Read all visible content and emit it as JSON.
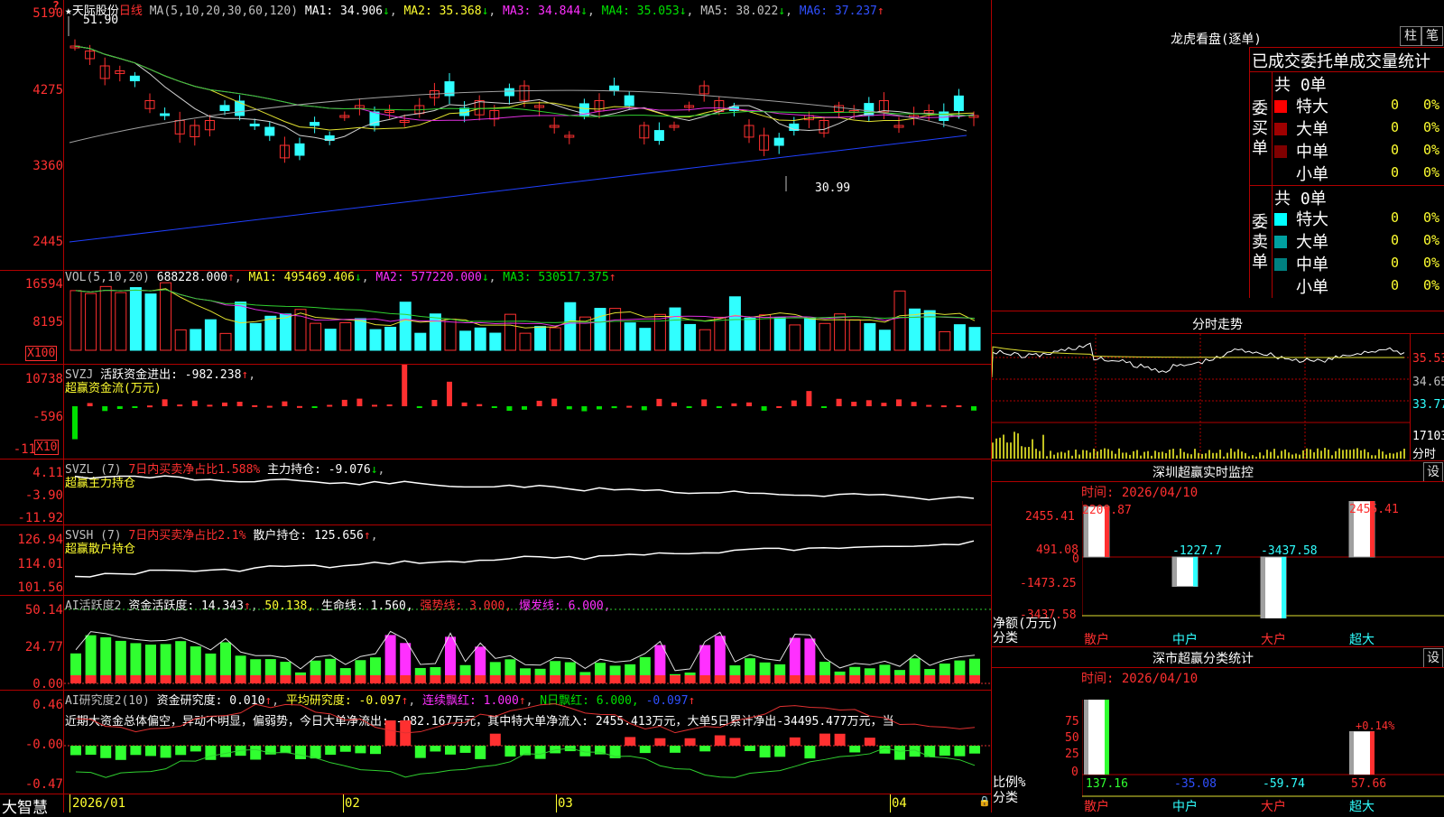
{
  "main": {
    "stock_name": "天际股份",
    "period": "日线",
    "ma_label": "MA(5,10,20,30,60,120)",
    "ma1": "MA1: 34.906",
    "ma2": "MA2: 35.368",
    "ma3": "MA3: 34.844",
    "ma4": "MA4: 35.053",
    "ma5": "MA5: 38.022",
    "ma6": "MA6: 37.237",
    "high_mark": "51.90",
    "low_mark": "30.99",
    "y_ticks": [
      "5190",
      "4275",
      "3360",
      "2445"
    ]
  },
  "vol": {
    "label": "VOL(5,10,20)",
    "value": "688228.000",
    "ma1": "MA1: 495469.406",
    "ma2": "MA2: 577220.000",
    "ma3": "MA3: 530517.375",
    "y_ticks": [
      "16594",
      "8195"
    ],
    "unit": "X100"
  },
  "svzj": {
    "label": "SVZJ",
    "text": "活跃资金进出: -982.238",
    "sub": "超赢资金流(万元)",
    "y_ticks": [
      "10738",
      "-596",
      "-11"
    ],
    "unit": "X10"
  },
  "svzl": {
    "label": "SVZL (7)",
    "text1": "7日内买卖净占比1.588%",
    "text2": "主力持仓: -9.076",
    "sub": "超赢主力持仓",
    "y_ticks": [
      "4.11",
      "-3.90",
      "-11.92"
    ]
  },
  "svsh": {
    "label": "SVSH (7)",
    "text1": "7日内买卖净占比2.1%",
    "text2": "散户持仓: 125.656",
    "sub": "超赢散户持仓",
    "y_ticks": [
      "126.94",
      "114.01",
      "101.56"
    ]
  },
  "ai1": {
    "label": "AI活跃度2",
    "text1": "资金活跃度: 14.343",
    "text2": "50.138,",
    "text3": "生命线: 1.560,",
    "text4": "强势线: 3.000,",
    "text5": "爆发线: 6.000,",
    "y_ticks": [
      "50.14",
      "24.77",
      "0.00"
    ]
  },
  "ai2": {
    "label": "AI研究度2(10)",
    "text1": "资金研究度: 0.010",
    "text2": "平均研究度: -0.097",
    "text3": "连续飘红: 1.000",
    "text4": "N日飘红: 6.000,",
    "text5": "-0.097",
    "comment": "近期大资金总体偏空，异动不明显，偏弱势，今日大单净流出: -982.167万元，其中特大单净流入: 2455.413万元，大单5日累计净出-34495.477万元，当",
    "y_ticks": [
      "0.46",
      "-0.00",
      "-0.47"
    ]
  },
  "bottom": {
    "brand": "大智慧",
    "dates": [
      "2026/01",
      "02",
      "03",
      "04"
    ]
  },
  "right": {
    "lhb_title": "龙虎看盘(逐单)",
    "btn_col": "柱",
    "btn_pen": "笔",
    "tabs_title": "已成交委托单成交量统计",
    "buy_group": "委买单",
    "sell_group": "委卖单",
    "buy_total": "共 0单",
    "sell_total": "共 0单",
    "rows": [
      "特大",
      "大单",
      "中单",
      "小单"
    ],
    "count": "0",
    "pct": "0%",
    "fenshi_title": "分时走势",
    "fenshi_prices": [
      "35.53",
      "34.65",
      "33.77"
    ],
    "fenshi_vol": "17103",
    "fenshi_unit": "分时",
    "monitor_title": "深圳超赢实时监控",
    "monitor_btn": "设",
    "monitor_time": "时间: 2026/04/10",
    "monitor_y": [
      "2455.41",
      "491.08",
      "0",
      "-1473.25",
      "-3437.58"
    ],
    "monitor_ylabel": "净额(万元)",
    "monitor_xlabel": "分类",
    "categories": [
      "散户",
      "中户",
      "大户",
      "超大"
    ],
    "monitor_values": [
      "2209.87",
      "-1227.7",
      "-3437.58",
      "2455.41"
    ],
    "stat_title": "深市超赢分类统计",
    "stat_btn": "设",
    "stat_time": "时间: 2026/04/10",
    "stat_y": [
      "75",
      "50",
      "25",
      "0"
    ],
    "stat_ylabel": "比例%",
    "stat_xlabel": "分类",
    "stat_values": [
      "137.16",
      "-35.08",
      "-59.74",
      "57.66"
    ],
    "stat_extra": "+0.14%"
  },
  "colors": {
    "grid": "#b00000",
    "up": "#ff3030",
    "down": "#30ffff",
    "bg": "#000000"
  }
}
